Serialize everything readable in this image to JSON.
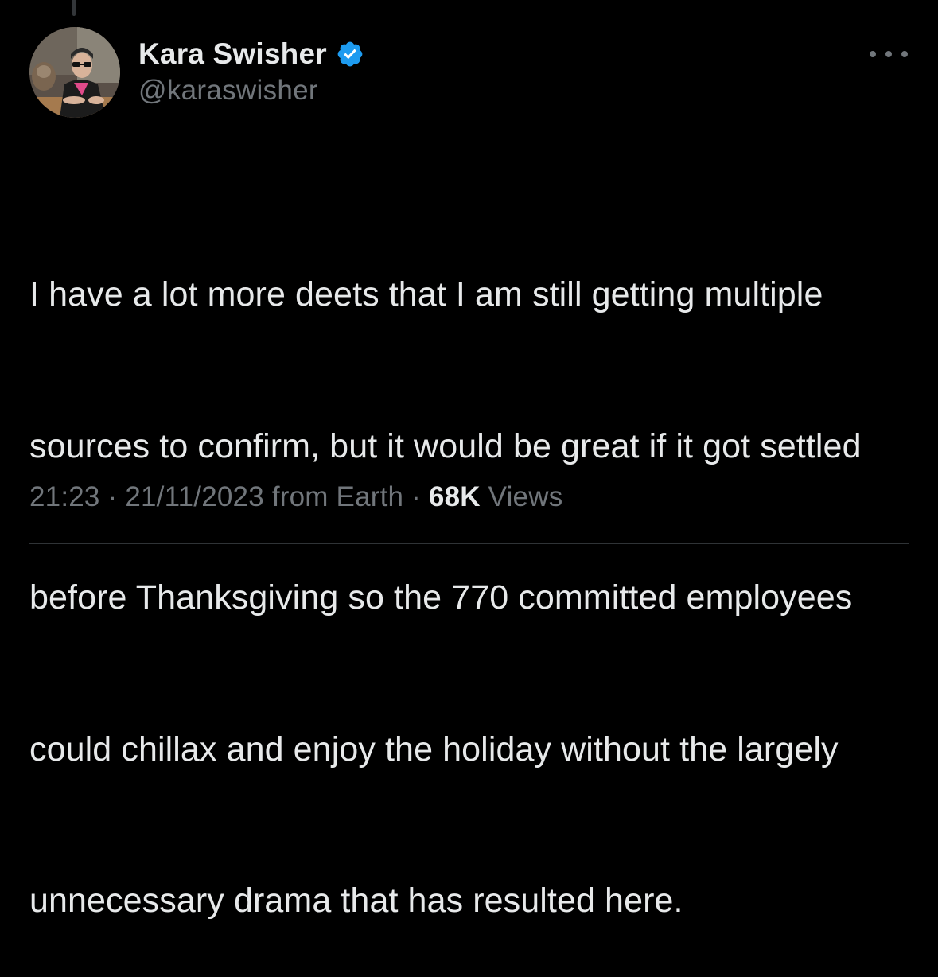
{
  "author": {
    "display_name": "Kara Swisher",
    "handle": "@karaswisher",
    "verified": true,
    "verified_color": "#1d9bf0"
  },
  "tweet": {
    "text_lines": [
      "I have a lot more deets that I am still getting multiple",
      "sources to confirm, but it would be great if it got settled",
      "before Thanksgiving so the 770 committed employees",
      "could chillax and enjoy the holiday without the largely",
      "unnecessary drama that has resulted here."
    ]
  },
  "meta": {
    "time": "21:23",
    "separator": " · ",
    "date": "21/11/2023",
    "source": " from Earth",
    "views_count": "68K",
    "views_label": " Views"
  },
  "icons": {
    "more": "more-horizontal-icon",
    "verified": "verified-badge-icon"
  },
  "colors": {
    "background": "#000000",
    "primary_text": "#e7e9ea",
    "secondary_text": "#71767b",
    "accent": "#1d9bf0"
  }
}
